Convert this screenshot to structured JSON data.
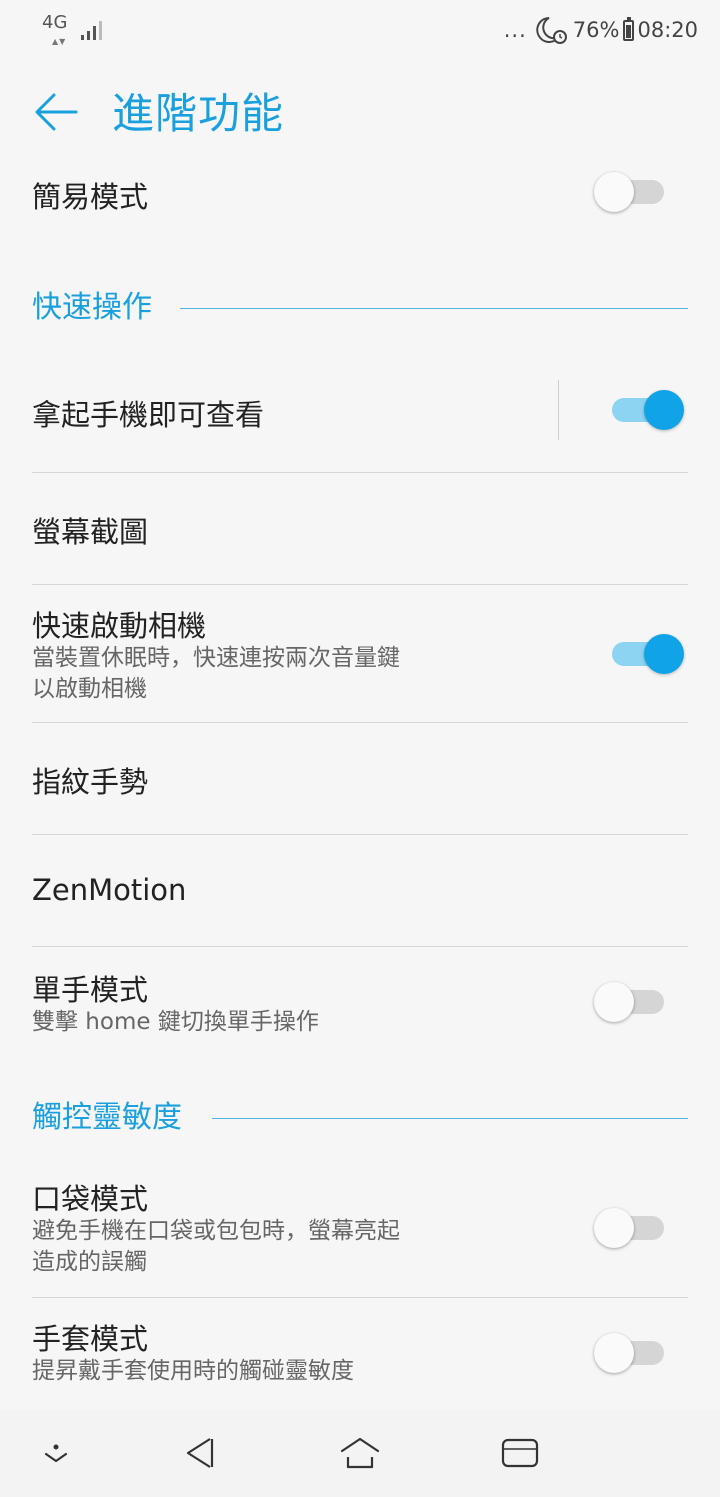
{
  "status_bar": {
    "network": "4G",
    "overflow": "...",
    "battery_percent": "76%",
    "time": "08:20",
    "icons": [
      "signal-icon",
      "moon-icon",
      "alarm-icon",
      "battery-icon"
    ]
  },
  "header": {
    "title": "進階功能",
    "back_icon": "arrow-left-icon"
  },
  "items": {
    "easy_mode": {
      "title": "簡易模式",
      "toggle_on": false
    },
    "section_quick": {
      "label": "快速操作"
    },
    "pickup": {
      "title": "拿起手機即可查看",
      "toggle_on": true
    },
    "screenshot": {
      "title": "螢幕截圖"
    },
    "quick_camera": {
      "title": "快速啟動相機",
      "subtitle": "當裝置休眠時，快速連按兩次音量鍵\n以啟動相機",
      "toggle_on": true
    },
    "fingerprint": {
      "title": "指紋手勢"
    },
    "zenmotion": {
      "title": "ZenMotion"
    },
    "one_hand": {
      "title": "單手模式",
      "subtitle": "雙擊 home 鍵切換單手操作",
      "toggle_on": false
    },
    "section_touch": {
      "label": "觸控靈敏度"
    },
    "pocket": {
      "title": "口袋模式",
      "subtitle": "避免手機在口袋或包包時，螢幕亮起\n造成的誤觸",
      "toggle_on": false
    },
    "glove": {
      "title": "手套模式",
      "subtitle": "提昇戴手套使用時的觸碰靈敏度",
      "toggle_on": false
    }
  },
  "nav_bar": {
    "icons": [
      "chevron-down-icon",
      "back-triangle-icon",
      "home-icon",
      "recents-icon"
    ]
  },
  "colors": {
    "accent": "#1aa0de",
    "toggle_on": "#11a3e8",
    "toggle_track_on": "#8dd3f2",
    "background": "#f6f6f6"
  }
}
